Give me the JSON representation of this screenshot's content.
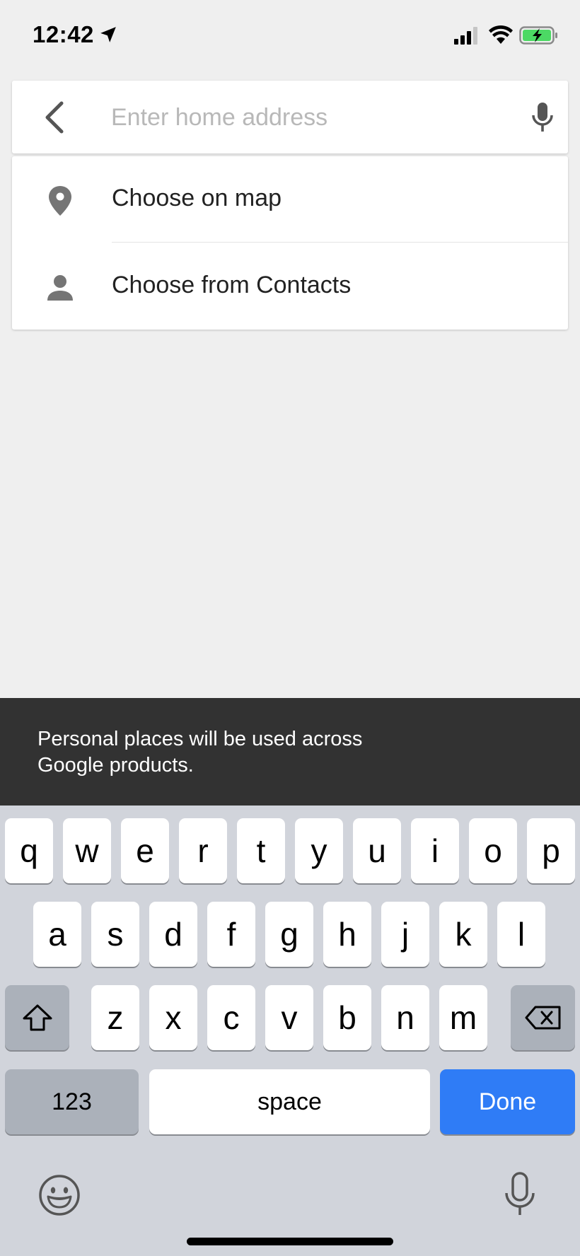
{
  "status_bar": {
    "time": "12:42",
    "icons": [
      "location-arrow-icon",
      "signal-icon",
      "wifi-icon",
      "battery-charging-icon"
    ]
  },
  "search": {
    "placeholder": "Enter home address",
    "value": ""
  },
  "options": [
    {
      "label": "Choose on map",
      "icon": "place-marker-icon"
    },
    {
      "label": "Choose from Contacts",
      "icon": "person-icon"
    }
  ],
  "snackbar": {
    "line1": "Personal places will be used across",
    "line2": "Google products."
  },
  "keyboard": {
    "row1": [
      "q",
      "w",
      "e",
      "r",
      "t",
      "y",
      "u",
      "i",
      "o",
      "p"
    ],
    "row2": [
      "a",
      "s",
      "d",
      "f",
      "g",
      "h",
      "j",
      "k",
      "l"
    ],
    "row3": [
      "z",
      "x",
      "c",
      "v",
      "b",
      "n",
      "m"
    ],
    "numbers_label": "123",
    "space_label": "space",
    "done_label": "Done"
  },
  "colors": {
    "background": "#efefef",
    "snackbar": "#323232",
    "keyboard": "#d1d4db",
    "done_key": "#2f7cf6",
    "icon_gray": "#757575"
  }
}
